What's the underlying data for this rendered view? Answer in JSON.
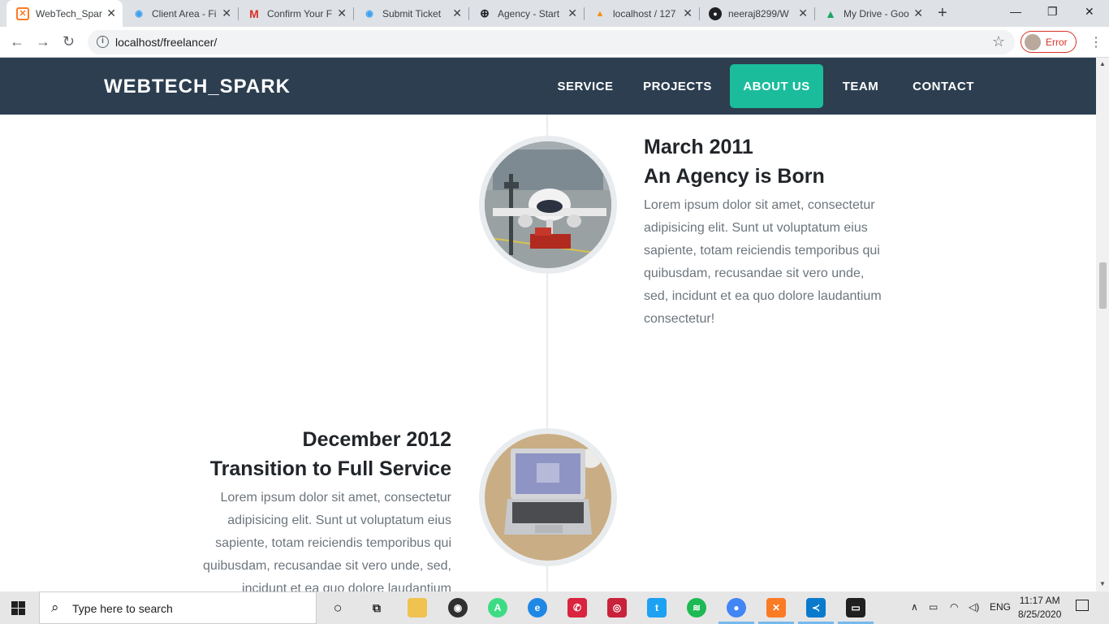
{
  "browser": {
    "tabs": [
      {
        "title": "WebTech_Spark",
        "icon": "xampp-icon",
        "color": "#fb7a24"
      },
      {
        "title": "Client Area - Fi",
        "icon": "client-area-icon",
        "color": "#3aa0ef"
      },
      {
        "title": "Confirm Your F",
        "icon": "gmail-icon",
        "color": "#d93025"
      },
      {
        "title": "Submit Ticket",
        "icon": "ticket-icon",
        "color": "#3aa0ef"
      },
      {
        "title": "Agency - Start",
        "icon": "globe-icon",
        "color": "#202124"
      },
      {
        "title": "localhost / 127",
        "icon": "phpmyadmin-icon",
        "color": "#f29111"
      },
      {
        "title": "neeraj8299/W",
        "icon": "github-icon",
        "color": "#202124"
      },
      {
        "title": "My Drive - Goo",
        "icon": "google-drive-icon",
        "color": "#1fa463"
      }
    ],
    "url": "localhost/freelancer/",
    "profile_label": "Error"
  },
  "site": {
    "brand": "WEBTECH_SPARK",
    "menu": [
      "SERVICE",
      "PROJECTS",
      "ABOUT US",
      "TEAM",
      "CONTACT"
    ],
    "active_menu": "ABOUT US",
    "colors": {
      "navbar": "#2c3e50",
      "accent": "#1abc9c"
    }
  },
  "timeline": [
    {
      "date": "March 2011",
      "title": "An Agency is Born",
      "body": "Lorem ipsum dolor sit amet, consectetur adipisicing elit. Sunt ut voluptatum eius sapiente, totam reiciendis temporibus qui quibusdam, recusandae sit vero unde, sed, incidunt et ea quo dolore laudantium consectetur!",
      "image": "airplane-photo"
    },
    {
      "date": "December 2012",
      "title": "Transition to Full Service",
      "body": "Lorem ipsum dolor sit amet, consectetur adipisicing elit. Sunt ut voluptatum eius sapiente, totam reiciendis temporibus qui quibusdam, recusandae sit vero unde, sed, incidunt et ea quo dolore laudantium",
      "image": "laptop-photo"
    }
  ],
  "taskbar": {
    "search_placeholder": "Type here to search",
    "language": "ENG",
    "time": "11:17 AM",
    "date": "8/25/2020"
  }
}
